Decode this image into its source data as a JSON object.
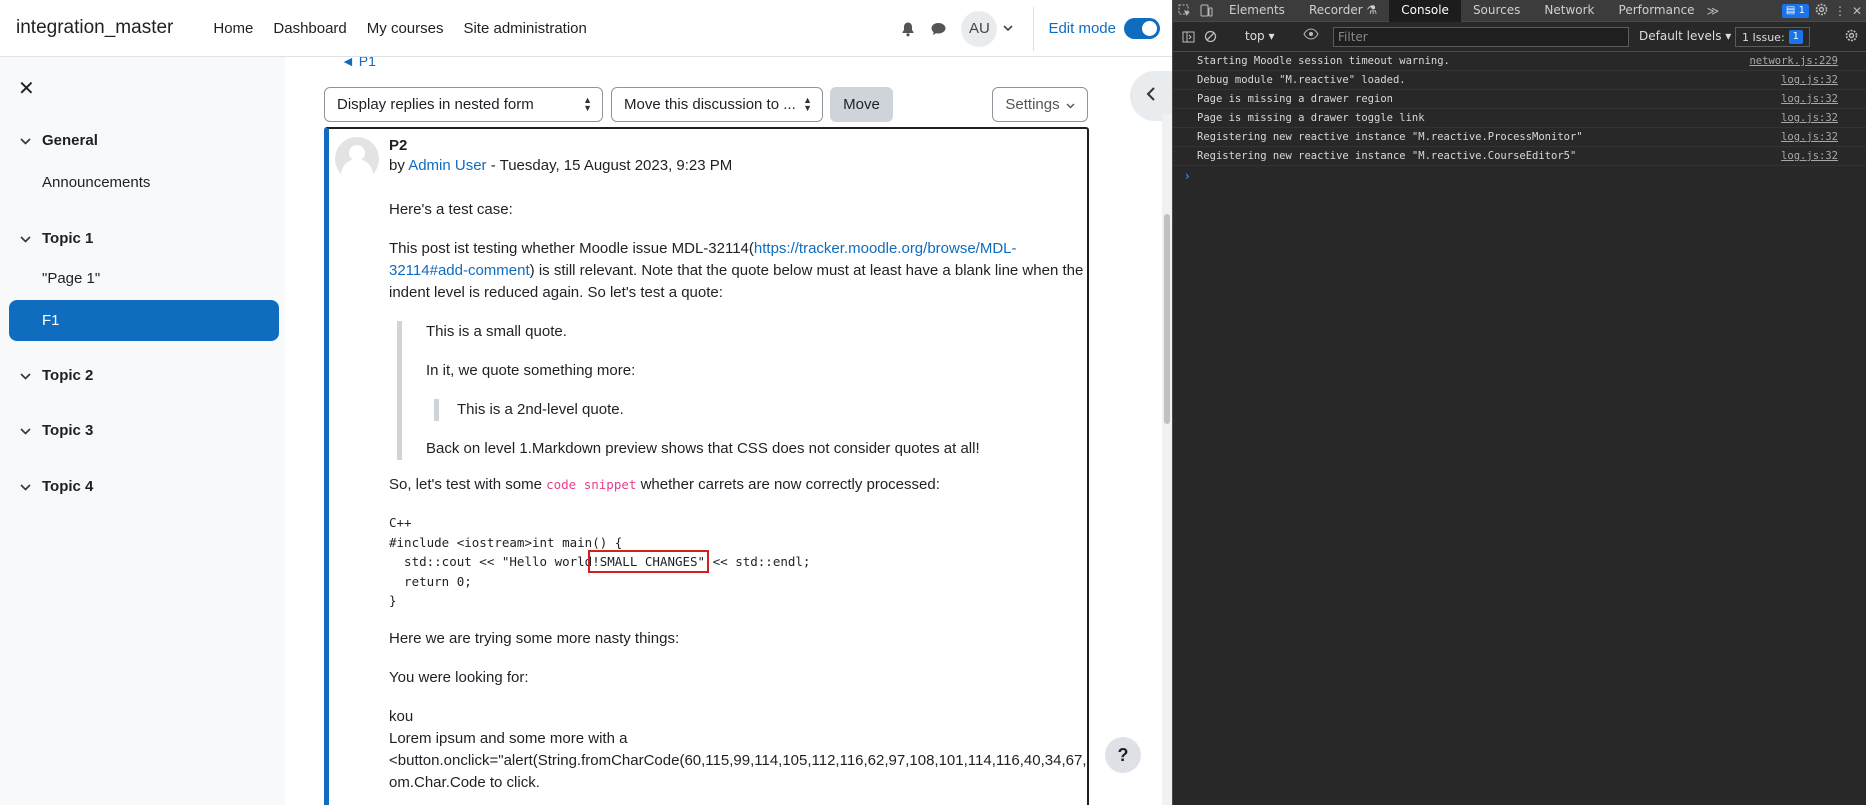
{
  "navbar": {
    "site_name": "integration_master",
    "links": [
      "Home",
      "Dashboard",
      "My courses",
      "Site administration"
    ],
    "avatar_initials": "AU",
    "edit_mode_label": "Edit mode"
  },
  "drawer": {
    "close_glyph": "✕",
    "sections": [
      {
        "label": "General",
        "items": [
          "Announcements"
        ]
      },
      {
        "label": "Topic 1",
        "items": [
          "\"Page 1\"",
          "F1"
        ]
      },
      {
        "label": "Topic 2",
        "items": []
      },
      {
        "label": "Topic 3",
        "items": []
      },
      {
        "label": "Topic 4",
        "items": []
      }
    ]
  },
  "discussion": {
    "back_link": "◄ P1",
    "display_mode": "Display replies in nested form",
    "move_select": "Move this discussion to ...",
    "move_button": "Move",
    "settings_button": "Settings",
    "help_glyph": "?"
  },
  "post": {
    "title": "P2",
    "by_prefix": "by",
    "author": "Admin User",
    "date": " - Tuesday, 15 August 2023, 9:23 PM",
    "p1": "Here's a test case:",
    "p2_a": "This post ist testing whether Moodle issue MDL-32114(",
    "p2_link_1": "https://tracker.moodle.org/browse/MDL-",
    "p2_link_2": "32114#add-comment",
    "p2_b": ") is still relevant. Note that the quote below must at least have a blank line when the indent level is reduced again. So let's test a quote:",
    "q1": "This is a small quote.",
    "q2": "In it, we quote something more:",
    "q3": "This is a 2nd-level quote.",
    "q4": "Back on level 1.Markdown preview shows that CSS does not consider quotes at all!",
    "p3_a": "So, let's test with some ",
    "p3_code": "code snippet",
    "p3_b": " whether carrets are now correctly processed:",
    "code_l1": "C++",
    "code_l2": "#include <iostream>int main() {",
    "code_l3_a": "  std::cout << \"Hello world",
    "code_l3_hl": "!SMALL CHANGES\"",
    "code_l3_b": " << std::endl;",
    "code_l4": "  return 0;",
    "code_l5": "}",
    "p4": "Here we are trying some more nasty things:",
    "p5": "You were looking for:",
    "p6_l1": "kou",
    "p6_l2": "Lorem ipsum and some more with a",
    "p6_l3": "<button.onclick=\"alert(String.fromCharCode(60,115,99,114,105,112,116,62,97,108,101,114,116,40,34,67,",
    "p6_l4": "om.Char.Code to click."
  },
  "devtools": {
    "tabs": [
      "Elements",
      "Recorder ⚗",
      "Console",
      "Sources",
      "Network",
      "Performance"
    ],
    "active_tab": "Console",
    "more_tabs": "≫",
    "badge_count": "1",
    "context": "top ▾",
    "filter_placeholder": "Filter",
    "levels": "Default levels ▾",
    "issues": "1 Issue:",
    "issues_count": "1",
    "messages": [
      {
        "text": "Starting Moodle session timeout warning.",
        "source": "network.js:229"
      },
      {
        "text": "Debug module \"M.reactive\" loaded.",
        "source": "log.js:32"
      },
      {
        "text": "Page is missing a drawer region",
        "source": "log.js:32"
      },
      {
        "text": "Page is missing a drawer toggle link",
        "source": "log.js:32"
      },
      {
        "text": "Registering new reactive instance \"M.reactive.ProcessMonitor\"",
        "source": "log.js:32"
      },
      {
        "text": "Registering new reactive instance \"M.reactive.CourseEditor5\"",
        "source": "log.js:32"
      }
    ],
    "prompt": "›"
  }
}
